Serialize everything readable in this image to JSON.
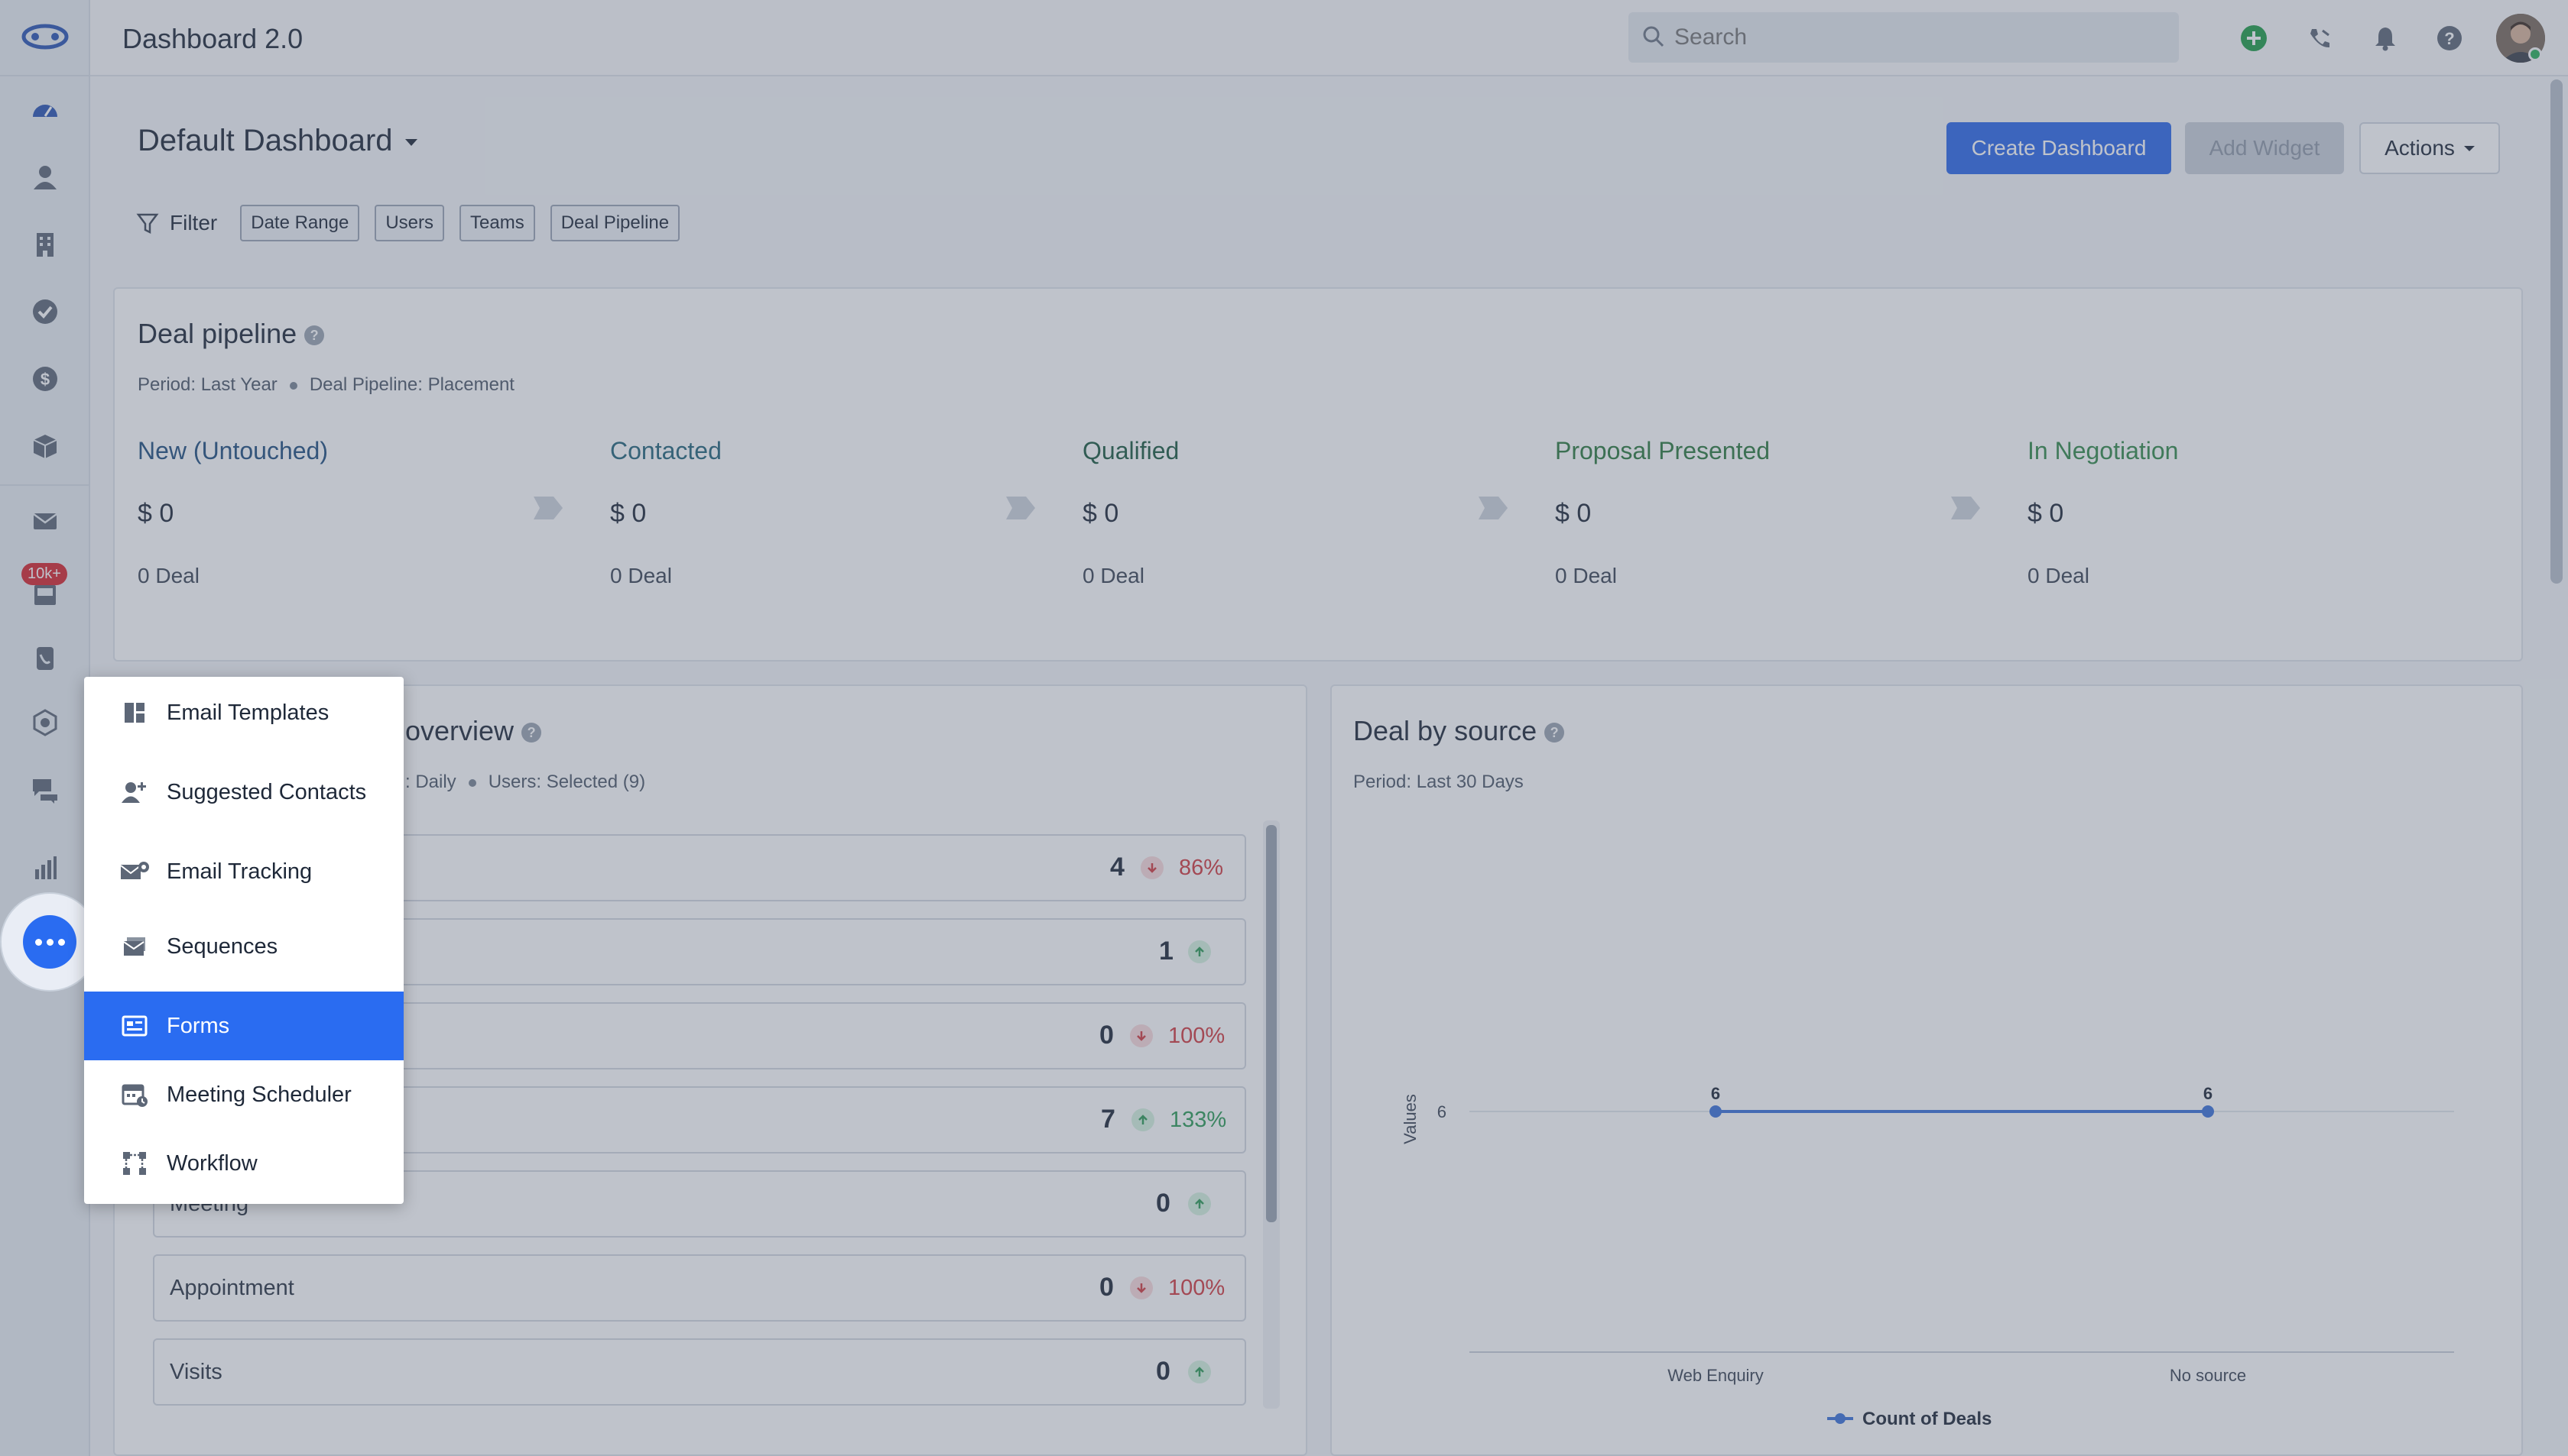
{
  "header": {
    "app_title": "Dashboard 2.0",
    "search_placeholder": "Search"
  },
  "dashboard": {
    "title": "Default Dashboard",
    "buttons": {
      "create": "Create Dashboard",
      "add_widget": "Add Widget",
      "actions": "Actions"
    },
    "filter_label": "Filter",
    "filter_chips": [
      "Date Range",
      "Users",
      "Teams",
      "Deal Pipeline"
    ]
  },
  "sidebar": {
    "badge": "10k+"
  },
  "deal_pipeline": {
    "title": "Deal pipeline",
    "period": "Period: Last Year",
    "pipeline": "Deal Pipeline: Placement",
    "stages": [
      {
        "name": "New (Untouched)",
        "amount": "$ 0",
        "count": "0 Deal",
        "color": "#1f4e7e"
      },
      {
        "name": "Contacted",
        "amount": "$ 0",
        "count": "0 Deal",
        "color": "#23647a"
      },
      {
        "name": "Qualified",
        "amount": "$ 0",
        "count": "0 Deal",
        "color": "#1b5a3f"
      },
      {
        "name": "Proposal Presented",
        "amount": "$ 0",
        "count": "0 Deal",
        "color": "#2c7a3e"
      },
      {
        "name": "In Negotiation",
        "amount": "$ 0",
        "count": "0 Deal",
        "color": "#33894a"
      }
    ]
  },
  "activity_overview": {
    "title_visible": "overview",
    "meta_visible": ": Daily",
    "users": "Users: Selected (9)",
    "rows": [
      {
        "label": "",
        "value": "4",
        "trend": "down",
        "pct": "86%"
      },
      {
        "label": "",
        "value": "1",
        "trend": "up",
        "pct": ""
      },
      {
        "label": "",
        "value": "0",
        "trend": "down",
        "pct": "100%"
      },
      {
        "label": "",
        "value": "7",
        "trend": "up",
        "pct": "133%"
      },
      {
        "label": "Meeting",
        "value": "0",
        "trend": "up",
        "pct": ""
      },
      {
        "label": "Appointment",
        "value": "0",
        "trend": "down",
        "pct": "100%"
      },
      {
        "label": "Visits",
        "value": "0",
        "trend": "up",
        "pct": ""
      }
    ]
  },
  "deal_by_source": {
    "title": "Deal by source",
    "period": "Period: Last 30 Days"
  },
  "chart_data": {
    "type": "line",
    "categories": [
      "Web Enquiry",
      "No source"
    ],
    "series": [
      {
        "name": "Count of Deals",
        "values": [
          6,
          6
        ]
      }
    ],
    "ylabel": "Values",
    "xlabel": "",
    "yticks": [
      6
    ],
    "data_labels": [
      "6",
      "6"
    ],
    "legend": "bottom",
    "color": "#3a72d8"
  },
  "more_menu": {
    "items": [
      {
        "label": "Email Templates",
        "icon": "template-icon"
      },
      {
        "label": "Suggested Contacts",
        "icon": "add-contact-icon"
      },
      {
        "label": "Email Tracking",
        "icon": "email-tracking-icon"
      },
      {
        "label": "Sequences",
        "icon": "sequences-icon"
      },
      {
        "label": "Forms",
        "icon": "forms-icon",
        "active": true
      },
      {
        "label": "Meeting Scheduler",
        "icon": "calendar-icon"
      },
      {
        "label": "Workflow",
        "icon": "workflow-icon"
      }
    ]
  }
}
